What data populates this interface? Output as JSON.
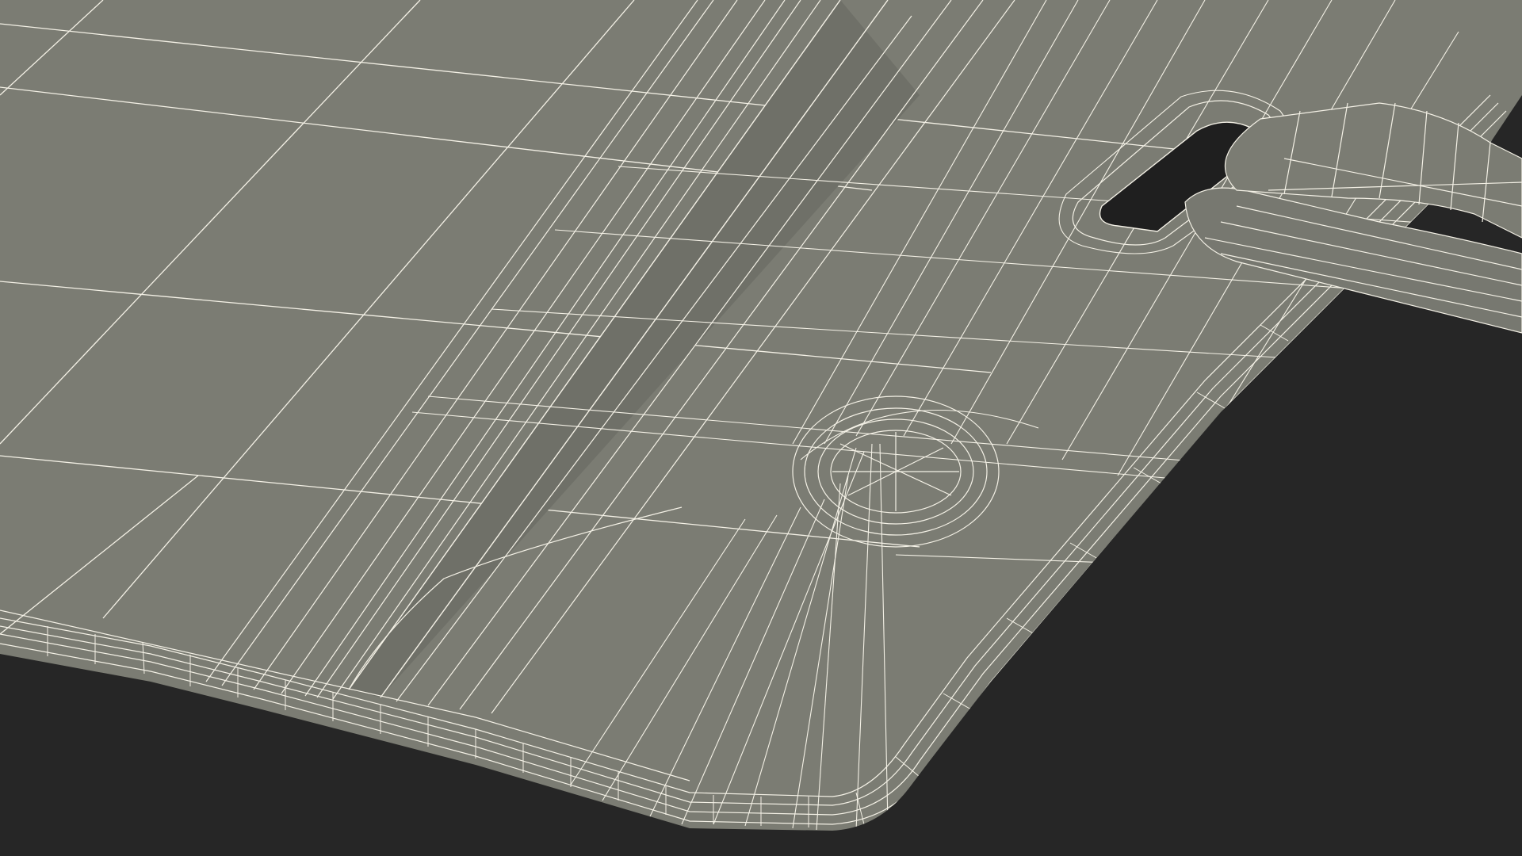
{
  "scene": {
    "background_color": "#262626",
    "surface_color": "#7b7c73",
    "shadow_color": "#1e1e1e",
    "wire_color": "#f4f1e6"
  }
}
